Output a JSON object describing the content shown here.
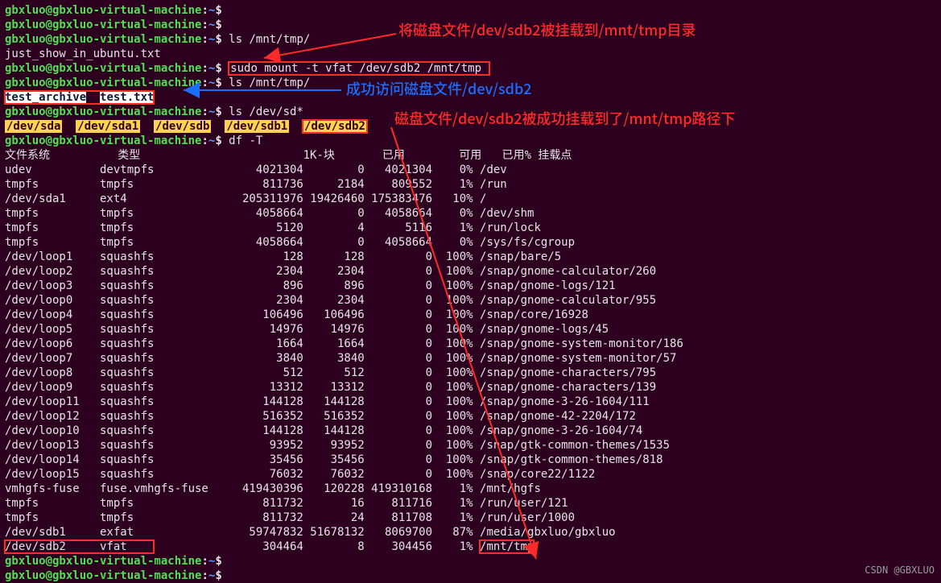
{
  "prompt": {
    "user": "gbxluo@gbxluo-virtual-machine",
    "sep": ":",
    "path": "~",
    "end": "$"
  },
  "lines": {
    "l0": "",
    "l1": "ls /mnt/tmp/",
    "l2": "just_show_in_ubuntu.txt",
    "l3": "sudo mount -t vfat /dev/sdb2 /mnt/tmp",
    "l4": "ls /mnt/tmp/",
    "l5a": "test_archive",
    "l5b": "  ",
    "l5c": "test.txt",
    "l6": "ls /dev/sd*",
    "l7a": "/dev/sda",
    "l7b": "/dev/sda1",
    "l7c": "/dev/sdb",
    "l7d": "/dev/sdb1",
    "l7e": "/dev/sdb2",
    "l8": "df -T"
  },
  "df": {
    "header": {
      "fs": "文件系统",
      "type": "类型",
      "blocks": "1K-块",
      "used": "已用",
      "avail": "可用",
      "usepct": "已用%",
      "mount": "挂载点"
    },
    "rows": [
      {
        "fs": "udev",
        "type": "devtmpfs",
        "blocks": "4021304",
        "used": "0",
        "avail": "4021304",
        "usepct": "0%",
        "mount": "/dev"
      },
      {
        "fs": "tmpfs",
        "type": "tmpfs",
        "blocks": "811736",
        "used": "2184",
        "avail": "809552",
        "usepct": "1%",
        "mount": "/run"
      },
      {
        "fs": "/dev/sda1",
        "type": "ext4",
        "blocks": "205311976",
        "used": "19426460",
        "avail": "175383476",
        "usepct": "10%",
        "mount": "/"
      },
      {
        "fs": "tmpfs",
        "type": "tmpfs",
        "blocks": "4058664",
        "used": "0",
        "avail": "4058664",
        "usepct": "0%",
        "mount": "/dev/shm"
      },
      {
        "fs": "tmpfs",
        "type": "tmpfs",
        "blocks": "5120",
        "used": "4",
        "avail": "5116",
        "usepct": "1%",
        "mount": "/run/lock"
      },
      {
        "fs": "tmpfs",
        "type": "tmpfs",
        "blocks": "4058664",
        "used": "0",
        "avail": "4058664",
        "usepct": "0%",
        "mount": "/sys/fs/cgroup"
      },
      {
        "fs": "/dev/loop1",
        "type": "squashfs",
        "blocks": "128",
        "used": "128",
        "avail": "0",
        "usepct": "100%",
        "mount": "/snap/bare/5"
      },
      {
        "fs": "/dev/loop2",
        "type": "squashfs",
        "blocks": "2304",
        "used": "2304",
        "avail": "0",
        "usepct": "100%",
        "mount": "/snap/gnome-calculator/260"
      },
      {
        "fs": "/dev/loop3",
        "type": "squashfs",
        "blocks": "896",
        "used": "896",
        "avail": "0",
        "usepct": "100%",
        "mount": "/snap/gnome-logs/121"
      },
      {
        "fs": "/dev/loop0",
        "type": "squashfs",
        "blocks": "2304",
        "used": "2304",
        "avail": "0",
        "usepct": "100%",
        "mount": "/snap/gnome-calculator/955"
      },
      {
        "fs": "/dev/loop4",
        "type": "squashfs",
        "blocks": "106496",
        "used": "106496",
        "avail": "0",
        "usepct": "100%",
        "mount": "/snap/core/16928"
      },
      {
        "fs": "/dev/loop5",
        "type": "squashfs",
        "blocks": "14976",
        "used": "14976",
        "avail": "0",
        "usepct": "100%",
        "mount": "/snap/gnome-logs/45"
      },
      {
        "fs": "/dev/loop6",
        "type": "squashfs",
        "blocks": "1664",
        "used": "1664",
        "avail": "0",
        "usepct": "100%",
        "mount": "/snap/gnome-system-monitor/186"
      },
      {
        "fs": "/dev/loop7",
        "type": "squashfs",
        "blocks": "3840",
        "used": "3840",
        "avail": "0",
        "usepct": "100%",
        "mount": "/snap/gnome-system-monitor/57"
      },
      {
        "fs": "/dev/loop8",
        "type": "squashfs",
        "blocks": "512",
        "used": "512",
        "avail": "0",
        "usepct": "100%",
        "mount": "/snap/gnome-characters/795"
      },
      {
        "fs": "/dev/loop9",
        "type": "squashfs",
        "blocks": "13312",
        "used": "13312",
        "avail": "0",
        "usepct": "100%",
        "mount": "/snap/gnome-characters/139"
      },
      {
        "fs": "/dev/loop11",
        "type": "squashfs",
        "blocks": "144128",
        "used": "144128",
        "avail": "0",
        "usepct": "100%",
        "mount": "/snap/gnome-3-26-1604/111"
      },
      {
        "fs": "/dev/loop12",
        "type": "squashfs",
        "blocks": "516352",
        "used": "516352",
        "avail": "0",
        "usepct": "100%",
        "mount": "/snap/gnome-42-2204/172"
      },
      {
        "fs": "/dev/loop10",
        "type": "squashfs",
        "blocks": "144128",
        "used": "144128",
        "avail": "0",
        "usepct": "100%",
        "mount": "/snap/gnome-3-26-1604/74"
      },
      {
        "fs": "/dev/loop13",
        "type": "squashfs",
        "blocks": "93952",
        "used": "93952",
        "avail": "0",
        "usepct": "100%",
        "mount": "/snap/gtk-common-themes/1535"
      },
      {
        "fs": "/dev/loop14",
        "type": "squashfs",
        "blocks": "35456",
        "used": "35456",
        "avail": "0",
        "usepct": "100%",
        "mount": "/snap/gtk-common-themes/818"
      },
      {
        "fs": "/dev/loop15",
        "type": "squashfs",
        "blocks": "76032",
        "used": "76032",
        "avail": "0",
        "usepct": "100%",
        "mount": "/snap/core22/1122"
      },
      {
        "fs": "vmhgfs-fuse",
        "type": "fuse.vmhgfs-fuse",
        "blocks": "419430396",
        "used": "120228",
        "avail": "419310168",
        "usepct": "1%",
        "mount": "/mnt/hgfs"
      },
      {
        "fs": "tmpfs",
        "type": "tmpfs",
        "blocks": "811732",
        "used": "16",
        "avail": "811716",
        "usepct": "1%",
        "mount": "/run/user/121"
      },
      {
        "fs": "tmpfs",
        "type": "tmpfs",
        "blocks": "811732",
        "used": "24",
        "avail": "811708",
        "usepct": "1%",
        "mount": "/run/user/1000"
      },
      {
        "fs": "/dev/sdb1",
        "type": "exfat",
        "blocks": "59747832",
        "used": "51678132",
        "avail": "8069700",
        "usepct": "87%",
        "mount": "/media/gbxluo/gbxluo"
      },
      {
        "fs": "/dev/sdb2",
        "type": "vfat",
        "blocks": "304464",
        "used": "8",
        "avail": "304456",
        "usepct": "1%",
        "mount": "/mnt/tmp"
      }
    ]
  },
  "annotations": {
    "a1": "将磁盘文件/dev/sdb2被挂载到/mnt/tmp目录",
    "a2": "成功访问磁盘文件/dev/sdb2",
    "a3": "磁盘文件/dev/sdb2被成功挂载到了/mnt/tmp路径下"
  },
  "watermark": "CSDN @GBXLUO"
}
